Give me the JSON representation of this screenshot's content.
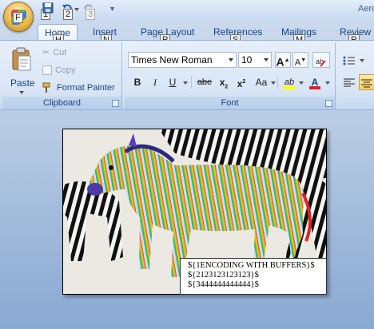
{
  "title_bar": {
    "window_title_fragment": "Aero",
    "keytips": {
      "office": "F",
      "qat1": "1",
      "qat2": "2",
      "qat3": "3"
    }
  },
  "tabs": [
    {
      "label": "Home",
      "keytip": "H",
      "active": true
    },
    {
      "label": "Insert",
      "keytip": "N"
    },
    {
      "label": "Page Layout",
      "keytip": "P"
    },
    {
      "label": "References",
      "keytip": "S"
    },
    {
      "label": "Mailings",
      "keytip": "M"
    },
    {
      "label": "Review",
      "keytip": "R"
    }
  ],
  "clipboard": {
    "group_label": "Clipboard",
    "paste_label": "Paste",
    "cut_label": "Cut",
    "copy_label": "Copy",
    "format_painter_label": "Format Painter"
  },
  "font": {
    "group_label": "Font",
    "font_name": "Times New Roman",
    "font_size": "10",
    "grow_label": "A",
    "shrink_label": "A",
    "bold": "B",
    "italic": "I",
    "underline": "U",
    "strikethrough": "abe",
    "subscript": "x",
    "superscript": "x",
    "change_case": "Aa",
    "highlight": "ab",
    "font_color": "A",
    "subscript_mark": "2",
    "superscript_mark": "2"
  },
  "document": {
    "textbox_lines": [
      "${1ENCODING WITH BUFFERS}$",
      "${2123123123123}$",
      "${3444444444444}$"
    ]
  },
  "colors": {
    "accent": "#15428b",
    "ribbon_border": "#8db2e3",
    "highlight_yellow": "#ffff00",
    "font_color_red": "#e02020"
  }
}
